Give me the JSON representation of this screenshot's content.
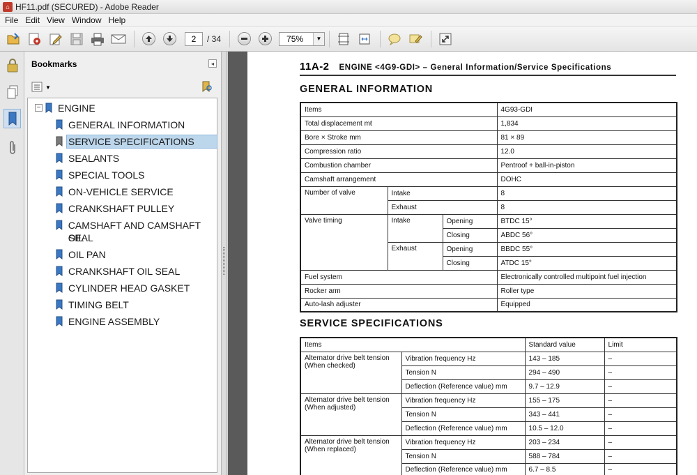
{
  "window": {
    "title": "HF11.pdf (SECURED) - Adobe Reader"
  },
  "menu": [
    "File",
    "Edit",
    "View",
    "Window",
    "Help"
  ],
  "toolbar": {
    "page_current": "2",
    "page_total": "/ 34",
    "zoom": "75%"
  },
  "bookmarks": {
    "title": "Bookmarks",
    "root": "ENGINE",
    "items": [
      "GENERAL INFORMATION",
      "SERVICE SPECIFICATIONS",
      "SEALANTS",
      "SPECIAL TOOLS",
      "ON-VEHICLE SERVICE",
      "CRANKSHAFT PULLEY",
      "CAMSHAFT AND CAMSHAFT OIL",
      "SEAL",
      "OIL PAN",
      "CRANKSHAFT OIL SEAL",
      "CYLINDER HEAD GASKET",
      "TIMING BELT",
      "ENGINE ASSEMBLY"
    ],
    "selected_index": 1
  },
  "document": {
    "page_number": "11A-2",
    "header": "ENGINE <4G9-GDI> – General Information/Service Specifications",
    "general_title": "GENERAL INFORMATION",
    "general": {
      "items_label": "Items",
      "items_value": "4G93-GDI",
      "displacement_label": "Total displacement mℓ",
      "displacement_value": "1,834",
      "bore_label": "Bore × Stroke mm",
      "bore_value": "81 × 89",
      "compression_label": "Compression ratio",
      "compression_value": "12.0",
      "chamber_label": "Combustion chamber",
      "chamber_value": "Pentroof + ball-in-piston",
      "camshaft_label": "Camshaft arrangement",
      "camshaft_value": "DOHC",
      "valves_label": "Number of valve",
      "intake_label": "Intake",
      "intake_value": "8",
      "exhaust_label": "Exhaust",
      "exhaust_value": "8",
      "timing_label": "Valve timing",
      "opening_label": "Opening",
      "closing_label": "Closing",
      "intake_opening": "BTDC 15°",
      "intake_closing": "ABDC 56°",
      "exhaust_opening": "BBDC 55°",
      "exhaust_closing": "ATDC 15°",
      "fuel_label": "Fuel system",
      "fuel_value": "Electronically controlled multipoint fuel injection",
      "rocker_label": "Rocker arm",
      "rocker_value": "Roller type",
      "lash_label": "Auto-lash adjuster",
      "lash_value": "Equipped"
    },
    "service_title": "SERVICE SPECIFICATIONS",
    "service": {
      "col_items": "Items",
      "col_standard": "Standard value",
      "col_limit": "Limit",
      "groups": [
        {
          "label": "Alternator drive belt tension (When checked)",
          "rows": [
            {
              "item": "Vibration frequency Hz",
              "std": "143 – 185",
              "limit": "–"
            },
            {
              "item": "Tension N",
              "std": "294 – 490",
              "limit": "–"
            },
            {
              "item": "Deflection (Reference value) mm",
              "std": "9.7 – 12.9",
              "limit": "–"
            }
          ]
        },
        {
          "label": "Alternator drive belt tension (When adjusted)",
          "rows": [
            {
              "item": "Vibration frequency Hz",
              "std": "155 – 175",
              "limit": "–"
            },
            {
              "item": "Tension N",
              "std": "343 – 441",
              "limit": "–"
            },
            {
              "item": "Deflection (Reference value) mm",
              "std": "10.5 – 12.0",
              "limit": "–"
            }
          ]
        },
        {
          "label": "Alternator drive belt tension (When replaced)",
          "rows": [
            {
              "item": "Vibration frequency Hz",
              "std": "203 – 234",
              "limit": "–"
            },
            {
              "item": "Tension N",
              "std": "588 – 784",
              "limit": "–"
            },
            {
              "item": "Deflection (Reference value) mm",
              "std": "6.7 – 8.5",
              "limit": "–"
            }
          ]
        }
      ]
    }
  }
}
